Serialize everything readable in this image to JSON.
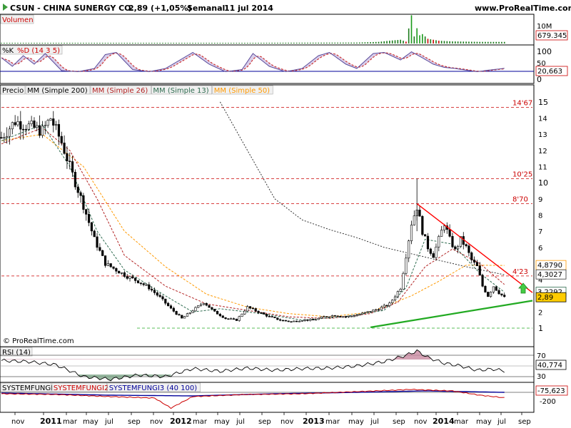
{
  "header": {
    "symbol_name": "CSUN - CHINA SUNERGY CO.",
    "quote": "2,89 (+1,05%)",
    "period": "Semanal",
    "date": "11 jul 2014",
    "site": "www.ProRealTime.com",
    "copyright": "© ProRealTime.com"
  },
  "colors": {
    "up": "#ffffff",
    "down": "#000000",
    "mm200": "#333333",
    "mm26": "#b22222",
    "mm13": "#2e6b4f",
    "mm50": "#ff9900",
    "support": "#22aa22",
    "resistance": "#ff0000",
    "levels": "#cc0000"
  },
  "panels": {
    "volume": {
      "label": "Volumen",
      "value_label": "679.345",
      "scale_label": "10M"
    },
    "stoch": {
      "label_k": "%K",
      "label_d": "%D (14 3 5)",
      "ticks": [
        "100",
        "50",
        "0"
      ],
      "value_label": "20,663"
    },
    "price": {
      "label": "Precio",
      "legend": [
        {
          "text": "MM (Simple 200)",
          "color": "#000000"
        },
        {
          "text": "MM (Simple 26)",
          "color": "#b22222"
        },
        {
          "text": "MM (Simple 13)",
          "color": "#2e6b4f"
        },
        {
          "text": "MM (Simple 50)",
          "color": "#ff9900"
        }
      ],
      "ticks": [
        "15",
        "14",
        "13",
        "12",
        "11",
        "10",
        "9",
        "8",
        "7",
        "6",
        "5",
        "4",
        "3",
        "2",
        "1"
      ],
      "levels": [
        {
          "label": "14'67",
          "value": 14.67
        },
        {
          "label": "10'25",
          "value": 10.25
        },
        {
          "label": "8'70",
          "value": 8.7
        },
        {
          "label": "4'23",
          "value": 4.23
        }
      ],
      "value_labels": [
        {
          "text": "4,8790",
          "color": "#ff9900",
          "value": 4.879
        },
        {
          "text": "4,3027",
          "color": "#333333",
          "value": 4.3027
        },
        {
          "text": "3,2292",
          "color": "#2e6b4f",
          "value": 3.2292
        },
        {
          "text": "2,89",
          "color": "#000000",
          "value": 2.89
        }
      ]
    },
    "rsi": {
      "label": "RSI (14)",
      "ticks": [
        "70",
        "30"
      ],
      "value_label": "40,774"
    },
    "systemfungi": {
      "labels": [
        {
          "text": "SYSTEMFUNGI",
          "color": "#000000"
        },
        {
          "text": "SYSTEMFUNGI2",
          "color": "#cc0000"
        },
        {
          "text": "SYSTEMFUNGI3 (40 100)",
          "color": "#000099"
        }
      ],
      "value_label": "-75,623",
      "ticks": [
        "-200"
      ]
    }
  },
  "x_axis": {
    "labels": [
      {
        "text": "nov",
        "bold": false
      },
      {
        "text": "2011",
        "bold": true
      },
      {
        "text": "mar",
        "bold": false
      },
      {
        "text": "may",
        "bold": false
      },
      {
        "text": "jul",
        "bold": false
      },
      {
        "text": "sep",
        "bold": false
      },
      {
        "text": "nov",
        "bold": false
      },
      {
        "text": "2012",
        "bold": true
      },
      {
        "text": "mar",
        "bold": false
      },
      {
        "text": "may",
        "bold": false
      },
      {
        "text": "jul",
        "bold": false
      },
      {
        "text": "sep",
        "bold": false
      },
      {
        "text": "nov",
        "bold": false
      },
      {
        "text": "2013",
        "bold": true
      },
      {
        "text": "mar",
        "bold": false
      },
      {
        "text": "may",
        "bold": false
      },
      {
        "text": "jul",
        "bold": false
      },
      {
        "text": "sep",
        "bold": false
      },
      {
        "text": "nov",
        "bold": false
      },
      {
        "text": "2014",
        "bold": true
      },
      {
        "text": "mar",
        "bold": false
      },
      {
        "text": "may",
        "bold": false
      },
      {
        "text": "jul",
        "bold": false
      },
      {
        "text": "sep",
        "bold": false
      }
    ]
  },
  "chart_data": {
    "type": "candlestick",
    "x_unit": "weeks from start (early Oct 2010)",
    "price_series": [
      {
        "week": 0,
        "value": 12.8
      },
      {
        "week": 5,
        "value": 13.8
      },
      {
        "week": 10,
        "value": 13.5
      },
      {
        "week": 15,
        "value": 13.2
      },
      {
        "week": 18,
        "value": 14.0
      },
      {
        "week": 22,
        "value": 12.5
      },
      {
        "week": 26,
        "value": 10.5
      },
      {
        "week": 30,
        "value": 8.6
      },
      {
        "week": 34,
        "value": 6.5
      },
      {
        "week": 38,
        "value": 5.0
      },
      {
        "week": 42,
        "value": 4.6
      },
      {
        "week": 46,
        "value": 4.2
      },
      {
        "week": 50,
        "value": 3.9
      },
      {
        "week": 54,
        "value": 3.5
      },
      {
        "week": 58,
        "value": 2.9
      },
      {
        "week": 62,
        "value": 2.2
      },
      {
        "week": 66,
        "value": 1.6
      },
      {
        "week": 70,
        "value": 2.1
      },
      {
        "week": 74,
        "value": 2.6
      },
      {
        "week": 78,
        "value": 2.0
      },
      {
        "week": 82,
        "value": 1.6
      },
      {
        "week": 86,
        "value": 1.5
      },
      {
        "week": 90,
        "value": 2.3
      },
      {
        "week": 94,
        "value": 2.0
      },
      {
        "week": 98,
        "value": 1.7
      },
      {
        "week": 102,
        "value": 1.5
      },
      {
        "week": 106,
        "value": 1.4
      },
      {
        "week": 110,
        "value": 1.5
      },
      {
        "week": 114,
        "value": 1.5
      },
      {
        "week": 118,
        "value": 1.7
      },
      {
        "week": 122,
        "value": 1.8
      },
      {
        "week": 126,
        "value": 1.7
      },
      {
        "week": 130,
        "value": 1.8
      },
      {
        "week": 134,
        "value": 2.0
      },
      {
        "week": 138,
        "value": 2.2
      },
      {
        "week": 142,
        "value": 2.5
      },
      {
        "week": 146,
        "value": 3.5
      },
      {
        "week": 148,
        "value": 5.5
      },
      {
        "week": 150,
        "value": 7.5
      },
      {
        "week": 152,
        "value": 8.5
      },
      {
        "week": 154,
        "value": 7.0
      },
      {
        "week": 156,
        "value": 6.0
      },
      {
        "week": 158,
        "value": 5.5
      },
      {
        "week": 160,
        "value": 6.5
      },
      {
        "week": 162,
        "value": 7.5
      },
      {
        "week": 164,
        "value": 6.5
      },
      {
        "week": 166,
        "value": 5.8
      },
      {
        "week": 168,
        "value": 6.5
      },
      {
        "week": 170,
        "value": 6.0
      },
      {
        "week": 172,
        "value": 5.2
      },
      {
        "week": 174,
        "value": 4.8
      },
      {
        "week": 176,
        "value": 3.6
      },
      {
        "week": 178,
        "value": 3.0
      },
      {
        "week": 180,
        "value": 3.6
      },
      {
        "week": 182,
        "value": 3.2
      },
      {
        "week": 184,
        "value": 2.89
      }
    ],
    "spike_high": {
      "week": 152,
      "value": 10.25
    },
    "moving_averages": {
      "mm200": [
        {
          "week": 80,
          "value": 15.0
        },
        {
          "week": 90,
          "value": 12.0
        },
        {
          "week": 100,
          "value": 9.0
        },
        {
          "week": 110,
          "value": 7.7
        },
        {
          "week": 120,
          "value": 7.1
        },
        {
          "week": 130,
          "value": 6.6
        },
        {
          "week": 140,
          "value": 6.0
        },
        {
          "week": 150,
          "value": 5.6
        },
        {
          "week": 160,
          "value": 5.2
        },
        {
          "week": 170,
          "value": 4.8
        },
        {
          "week": 184,
          "value": 4.3027
        }
      ],
      "mm50": [
        {
          "week": 0,
          "value": 12.6
        },
        {
          "week": 15,
          "value": 13.0
        },
        {
          "week": 30,
          "value": 11.0
        },
        {
          "week": 45,
          "value": 7.0
        },
        {
          "week": 60,
          "value": 4.8
        },
        {
          "week": 75,
          "value": 3.1
        },
        {
          "week": 90,
          "value": 2.3
        },
        {
          "week": 105,
          "value": 1.9
        },
        {
          "week": 120,
          "value": 1.7
        },
        {
          "week": 135,
          "value": 2.0
        },
        {
          "week": 150,
          "value": 3.0
        },
        {
          "week": 160,
          "value": 3.9
        },
        {
          "week": 170,
          "value": 4.9
        },
        {
          "week": 184,
          "value": 4.879
        }
      ],
      "mm26": [
        {
          "week": 0,
          "value": 12.4
        },
        {
          "week": 15,
          "value": 13.4
        },
        {
          "week": 25,
          "value": 12.0
        },
        {
          "week": 35,
          "value": 9.0
        },
        {
          "week": 45,
          "value": 5.5
        },
        {
          "week": 60,
          "value": 3.6
        },
        {
          "week": 75,
          "value": 2.5
        },
        {
          "week": 90,
          "value": 2.1
        },
        {
          "week": 105,
          "value": 1.7
        },
        {
          "week": 120,
          "value": 1.6
        },
        {
          "week": 135,
          "value": 1.9
        },
        {
          "week": 145,
          "value": 2.6
        },
        {
          "week": 155,
          "value": 4.8
        },
        {
          "week": 165,
          "value": 5.9
        },
        {
          "week": 175,
          "value": 5.0
        },
        {
          "week": 184,
          "value": 3.7
        }
      ],
      "mm13": [
        {
          "week": 0,
          "value": 12.6
        },
        {
          "week": 15,
          "value": 13.6
        },
        {
          "week": 25,
          "value": 11.0
        },
        {
          "week": 35,
          "value": 7.0
        },
        {
          "week": 45,
          "value": 4.6
        },
        {
          "week": 60,
          "value": 3.0
        },
        {
          "week": 70,
          "value": 2.0
        },
        {
          "week": 80,
          "value": 2.2
        },
        {
          "week": 95,
          "value": 1.9
        },
        {
          "week": 110,
          "value": 1.5
        },
        {
          "week": 125,
          "value": 1.7
        },
        {
          "week": 140,
          "value": 2.1
        },
        {
          "week": 148,
          "value": 3.5
        },
        {
          "week": 155,
          "value": 6.5
        },
        {
          "week": 165,
          "value": 6.2
        },
        {
          "week": 175,
          "value": 4.4
        },
        {
          "week": 184,
          "value": 3.2292
        }
      ]
    },
    "trendlines": {
      "support": [
        {
          "week": 135,
          "value": 1.05
        },
        {
          "week": 200,
          "value": 2.7
        }
      ],
      "resistance": [
        {
          "week": 152,
          "value": 8.7
        },
        {
          "week": 198,
          "value": 3.2
        }
      ]
    },
    "horizontal_levels": [
      14.67,
      10.25,
      8.7,
      4.23,
      1.0
    ],
    "y_axis": {
      "min": 0,
      "max": 16,
      "ticks": [
        1,
        2,
        3,
        4,
        5,
        6,
        7,
        8,
        9,
        10,
        11,
        12,
        13,
        14,
        15
      ]
    },
    "volume": [
      {
        "week": 0,
        "value": 0.3
      },
      {
        "week": 40,
        "value": 0.3
      },
      {
        "week": 90,
        "value": 0.3
      },
      {
        "week": 130,
        "value": 0.4
      },
      {
        "week": 138,
        "value": 0.7
      },
      {
        "week": 142,
        "value": 1.2
      },
      {
        "week": 146,
        "value": 1.6
      },
      {
        "week": 148,
        "value": 0.8
      },
      {
        "week": 150,
        "value": 12.0
      },
      {
        "week": 151,
        "value": 3.0
      },
      {
        "week": 152,
        "value": 6.5
      },
      {
        "week": 153,
        "value": 3.5
      },
      {
        "week": 154,
        "value": 4.0
      },
      {
        "week": 156,
        "value": 2.0
      },
      {
        "week": 158,
        "value": 1.6
      },
      {
        "week": 160,
        "value": 1.2
      },
      {
        "week": 165,
        "value": 0.9
      },
      {
        "week": 170,
        "value": 0.8
      },
      {
        "week": 175,
        "value": 0.7
      },
      {
        "week": 184,
        "value": 0.68
      }
    ],
    "stochastic_k": [
      {
        "week": 0,
        "value": 70
      },
      {
        "week": 4,
        "value": 30
      },
      {
        "week": 8,
        "value": 80
      },
      {
        "week": 12,
        "value": 40
      },
      {
        "week": 16,
        "value": 90
      },
      {
        "week": 22,
        "value": 10
      },
      {
        "week": 28,
        "value": 5
      },
      {
        "week": 34,
        "value": 20
      },
      {
        "week": 38,
        "value": 85
      },
      {
        "week": 42,
        "value": 95
      },
      {
        "week": 48,
        "value": 15
      },
      {
        "week": 54,
        "value": 5
      },
      {
        "week": 60,
        "value": 20
      },
      {
        "week": 64,
        "value": 50
      },
      {
        "week": 70,
        "value": 95
      },
      {
        "week": 76,
        "value": 40
      },
      {
        "week": 82,
        "value": 5
      },
      {
        "week": 88,
        "value": 15
      },
      {
        "week": 92,
        "value": 90
      },
      {
        "week": 98,
        "value": 30
      },
      {
        "week": 104,
        "value": 5
      },
      {
        "week": 110,
        "value": 20
      },
      {
        "week": 116,
        "value": 80
      },
      {
        "week": 120,
        "value": 95
      },
      {
        "week": 126,
        "value": 40
      },
      {
        "week": 130,
        "value": 20
      },
      {
        "week": 136,
        "value": 90
      },
      {
        "week": 140,
        "value": 95
      },
      {
        "week": 146,
        "value": 60
      },
      {
        "week": 150,
        "value": 98
      },
      {
        "week": 154,
        "value": 70
      },
      {
        "week": 158,
        "value": 40
      },
      {
        "week": 162,
        "value": 25
      },
      {
        "week": 166,
        "value": 20
      },
      {
        "week": 170,
        "value": 12
      },
      {
        "week": 174,
        "value": 5
      },
      {
        "week": 178,
        "value": 12
      },
      {
        "week": 184,
        "value": 20.663
      }
    ],
    "rsi": [
      {
        "week": 0,
        "value": 60
      },
      {
        "week": 10,
        "value": 58
      },
      {
        "week": 20,
        "value": 52
      },
      {
        "week": 30,
        "value": 30
      },
      {
        "week": 40,
        "value": 25
      },
      {
        "week": 50,
        "value": 33
      },
      {
        "week": 60,
        "value": 30
      },
      {
        "week": 70,
        "value": 45
      },
      {
        "week": 80,
        "value": 40
      },
      {
        "week": 90,
        "value": 46
      },
      {
        "week": 100,
        "value": 42
      },
      {
        "week": 110,
        "value": 45
      },
      {
        "week": 120,
        "value": 46
      },
      {
        "week": 130,
        "value": 50
      },
      {
        "week": 140,
        "value": 58
      },
      {
        "week": 148,
        "value": 70
      },
      {
        "week": 152,
        "value": 78
      },
      {
        "week": 156,
        "value": 66
      },
      {
        "week": 162,
        "value": 55
      },
      {
        "week": 168,
        "value": 50
      },
      {
        "week": 174,
        "value": 42
      },
      {
        "week": 180,
        "value": 44
      },
      {
        "week": 184,
        "value": 40.774
      }
    ],
    "systemfungi": [
      {
        "week": 0,
        "value": -20
      },
      {
        "week": 20,
        "value": -30
      },
      {
        "week": 40,
        "value": -60
      },
      {
        "week": 56,
        "value": -80
      },
      {
        "week": 62,
        "value": -220
      },
      {
        "week": 70,
        "value": -60
      },
      {
        "week": 90,
        "value": -30
      },
      {
        "week": 110,
        "value": -20
      },
      {
        "week": 130,
        "value": 10
      },
      {
        "week": 150,
        "value": 40
      },
      {
        "week": 165,
        "value": 20
      },
      {
        "week": 175,
        "value": -40
      },
      {
        "week": 184,
        "value": -75.623
      }
    ],
    "systemfungi3": [
      {
        "week": 0,
        "value": -10
      },
      {
        "week": 40,
        "value": -40
      },
      {
        "week": 70,
        "value": -50
      },
      {
        "week": 100,
        "value": -20
      },
      {
        "week": 130,
        "value": 0
      },
      {
        "week": 155,
        "value": 20
      },
      {
        "week": 184,
        "value": 0
      }
    ]
  }
}
